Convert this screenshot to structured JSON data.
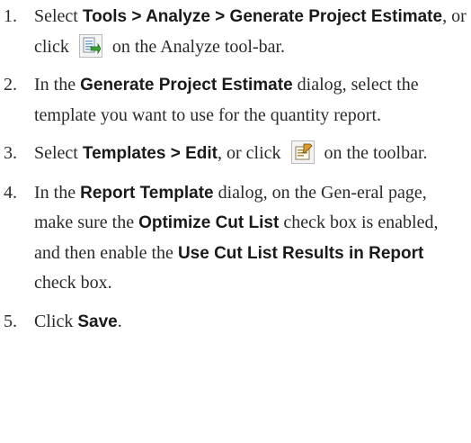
{
  "steps": [
    {
      "number": "1.",
      "before": "Select ",
      "bold1": "Tools > Analyze > Generate Project Estimate",
      "middle": ", or click ",
      "icon": "generate-estimate-icon",
      "after": " on the Analyze tool-bar."
    },
    {
      "number": "2.",
      "before": "In the ",
      "bold1": "Generate Project Estimate",
      "after": " dialog, select the template you want to use for the quantity report."
    },
    {
      "number": "3.",
      "before": "Select ",
      "bold1": "Templates > Edit",
      "middle": ", or click ",
      "icon": "edit-template-icon",
      "after": " on the toolbar."
    },
    {
      "number": "4.",
      "before": "In the  ",
      "bold1": "Report Template",
      "middle": " dialog, on the Gen-eral page, make sure the ",
      "bold2": "Optimize Cut List",
      "middle2": " check box is enabled, and then enable the ",
      "bold3": "Use Cut List Results in Report",
      "after": " check box."
    },
    {
      "number": "5.",
      "before": "Click ",
      "bold1": "Save",
      "after": "."
    }
  ]
}
